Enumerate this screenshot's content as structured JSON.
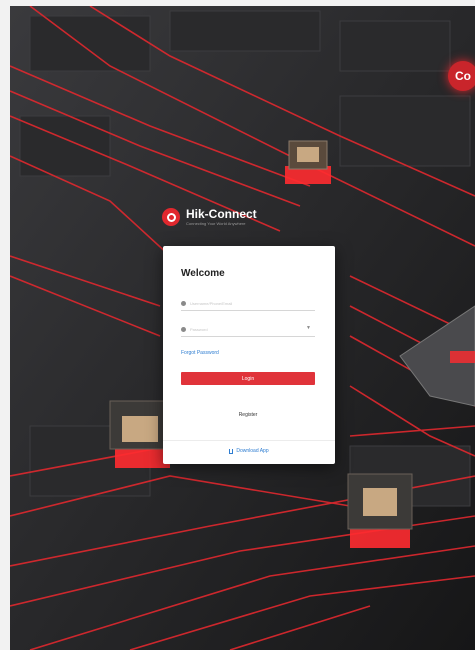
{
  "brand": {
    "name": "Hik-Connect",
    "tagline": "Connecting Your World Anywhere",
    "corner_badge": "Co"
  },
  "login": {
    "title": "Welcome",
    "username_placeholder": "Username/Phone/Email",
    "password_placeholder": "Password",
    "forgot_label": "Forgot Password",
    "login_label": "Login",
    "register_label": "Register",
    "download_label": "Download App"
  },
  "colors": {
    "accent": "#e0333a",
    "link": "#2e7dd1",
    "background": "#1e1e20"
  },
  "icons": [
    "hik-logo-icon",
    "user-icon",
    "lock-icon",
    "chevron-down-icon",
    "download-icon"
  ]
}
